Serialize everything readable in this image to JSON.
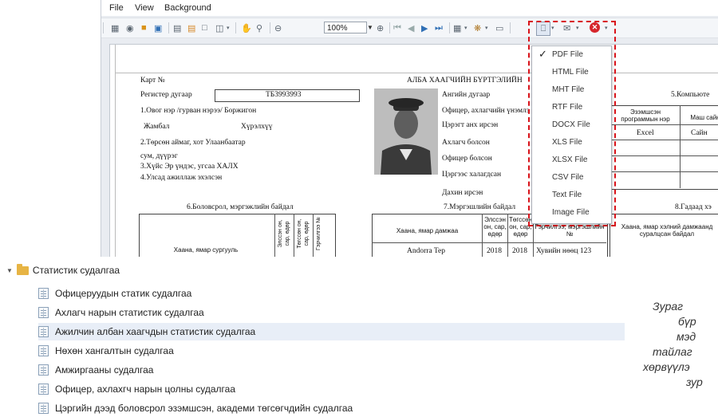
{
  "menu": {
    "file": "File",
    "view": "View",
    "background": "Background"
  },
  "toolbar": {
    "zoom": "100%"
  },
  "export_menu": {
    "items": [
      "PDF File",
      "HTML File",
      "MHT File",
      "RTF File",
      "DOCX File",
      "XLS File",
      "XLSX File",
      "CSV File",
      "Text File",
      "Image File"
    ],
    "checked": "PDF File"
  },
  "document": {
    "card_no": "Карт №",
    "title": "АЛБА ХААГЧИЙН БҮРТГЭЛИЙН",
    "reg_label": "Регистер дугаар",
    "reg_value": "ТБ3993993",
    "name_line": "1.Овог нэр /гурван нэрээ/  Боржигон",
    "given_name": "Жамбал",
    "father_name": "Хүрэлхүү",
    "birth_line": "2.Төрсөн аймаг, хот     Улаанбаатар",
    "soum": "сум, дүүрэг",
    "gender_line": "3.Хүйс     Эр    үндэс, угсаа       ХАЛХ",
    "start_line": "4.Улсад ажиллаж эхэлсэн",
    "field_1": "Ангийн дугаар",
    "field_2": "Офицер, ахлагчийн үнэмлэ",
    "field_3": "Цэрэгт анх ирсэн",
    "field_4": "Ахлагч болсон",
    "field_5": "Офицер болсон",
    "field_6": "Цэргээс халагдсан",
    "field_7": "Дахин ирсэн",
    "computer_heading": "5.Компьюте",
    "comp_col1": "Эзэмшсэн программын нэр",
    "comp_col2": "Маш сайн",
    "comp_val1": "Excel",
    "comp_val2": "Сайн",
    "edu_heading": "6.Боловсрол, мэргэжлийн байдал",
    "edu_col": "Хаана, ямар сургууль",
    "edu_v1": "Элссэн он, сар, өдөр",
    "edu_v2": "Төгссөн он, сар, өдөр",
    "edu_v3": "Гэрчилгээ №",
    "career_heading": "7.Мэргэшлийн байдал",
    "career_col1": "Хаана, ямар дамжаа",
    "career_col2": "Элссэн он, сар, өдөр",
    "career_col3": "Төгссөн он, сар, өдөр",
    "career_col4": "Гэрчилгээ, мэргэшлийн №",
    "career_row_place": "Andorra Tep",
    "career_row_y1": "2018",
    "career_row_y2": "2018",
    "career_row_cert": "Хувийн нөөц 123",
    "foreign_heading": "8.Гадаад хэ",
    "foreign_col": "Хаана, ямар хэлний дамжаанд суралцсан байдал"
  },
  "tree": {
    "root": "Статистик судалгаа",
    "items": [
      "Офицеруудын статик судалгаа",
      "Ахлагч нарын статистик судалгаа",
      "Ажилчин албан хаагчдын статистик судалгаа",
      "Нөхөн хангалтын судалгаа",
      "Амжиргааны судалгаа",
      "Офицер, ахлахгч нарын цолны судалгаа",
      "Цэргийн дээд боловсрол эзэмшсэн, академи төгсөгчдийн судалгаа"
    ]
  },
  "caption": [
    "Зураг",
    "бүр",
    "мэд",
    "тайлаг",
    "хөрвүүлэ",
    "зур"
  ]
}
